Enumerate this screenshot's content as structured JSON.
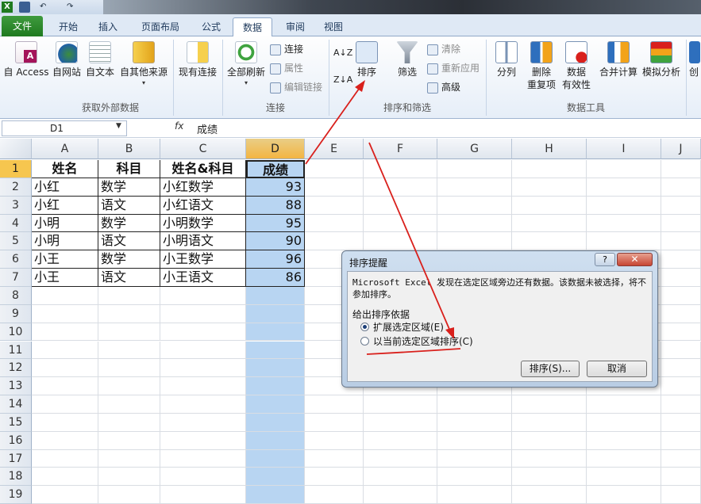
{
  "quick_access": {
    "excel_icon": "X",
    "save_icon": "save-icon",
    "undo": "↶",
    "redo": "↷"
  },
  "tabs": [
    "文件",
    "开始",
    "插入",
    "页面布局",
    "公式",
    "数据",
    "审阅",
    "视图"
  ],
  "active_tab": "数据",
  "ribbon": {
    "external": {
      "buttons": [
        "自 Access",
        "自网站",
        "自文本",
        "自其他来源",
        "现有连接"
      ],
      "group_label": "获取外部数据"
    },
    "connections": {
      "refresh_all": "全部刷新",
      "items": [
        "连接",
        "属性",
        "编辑链接"
      ],
      "group_label": "连接"
    },
    "sort_filter": {
      "sort_az": "A↓Z",
      "sort_za": "Z↓A",
      "sort": "排序",
      "filter": "筛选",
      "items": [
        "清除",
        "重新应用",
        "高级"
      ],
      "group_label": "排序和筛选"
    },
    "data_tools": {
      "split": "分列",
      "remove_dup": [
        "删除",
        "重复项"
      ],
      "validation": [
        "数据",
        "有效性"
      ],
      "consolidate": "合并计算",
      "whatif": "模拟分析",
      "create": "创",
      "group_label": "数据工具"
    }
  },
  "formula_bar": {
    "name_box": "D1",
    "fx": "fx",
    "content": "成绩"
  },
  "sheet": {
    "columns": [
      "A",
      "B",
      "C",
      "D",
      "E",
      "F",
      "G",
      "H",
      "I",
      "J"
    ],
    "rows": [
      "1",
      "2",
      "3",
      "4",
      "5",
      "6",
      "7",
      "8",
      "9",
      "10",
      "11",
      "12",
      "13",
      "14",
      "15",
      "16",
      "17",
      "18",
      "19"
    ],
    "header": [
      "姓名",
      "科目",
      "姓名&科目",
      "成绩"
    ],
    "data": [
      [
        "小红",
        "数学",
        "小红数学",
        "93"
      ],
      [
        "小红",
        "语文",
        "小红语文",
        "88"
      ],
      [
        "小明",
        "数学",
        "小明数学",
        "95"
      ],
      [
        "小明",
        "语文",
        "小明语文",
        "90"
      ],
      [
        "小王",
        "数学",
        "小王数学",
        "96"
      ],
      [
        "小王",
        "语文",
        "小王语文",
        "86"
      ]
    ]
  },
  "dialog": {
    "title": "排序提醒",
    "help": "?",
    "close": "✕",
    "message": "Microsoft Excel 发现在选定区域旁边还有数据。该数据未被选择，将不参加排序。",
    "basis_label": "给出排序依据",
    "options": [
      "扩展选定区域(E)",
      "以当前选定区域排序(C)"
    ],
    "selected_option": 0,
    "ok": "排序(S)...",
    "cancel": "取消"
  },
  "colors": {
    "annotation": "#d9201c",
    "file_tab": "#2e8b2e",
    "selection": "#b8d5f2"
  }
}
